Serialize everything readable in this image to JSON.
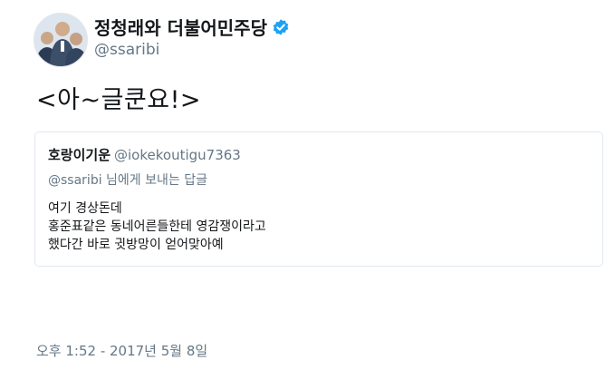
{
  "tweet": {
    "author": {
      "display_name": "정청래와 더불어민주당",
      "handle": "@ssaribi",
      "verified": true
    },
    "text": "<아~글쿤요!>",
    "quoted": {
      "display_name": "호랑이기운",
      "handle": "@iokekoutigu7363",
      "reply_mention": "@ssaribi",
      "reply_suffix": " 님에게 보내는 답글",
      "lines": [
        "여기 경상돈데",
        "홍준표같은 동네어른들한테 영감쟁이라고",
        "했다간 바로 귓방망이 얻어맞아예"
      ]
    },
    "timestamp": "오후 1:52 - 2017년 5월 8일"
  },
  "colors": {
    "text": "#14171a",
    "secondary": "#657786",
    "verified": "#1da1f2",
    "border": "#e1e8ed"
  },
  "icons": {
    "verified": "verified-badge-icon"
  }
}
